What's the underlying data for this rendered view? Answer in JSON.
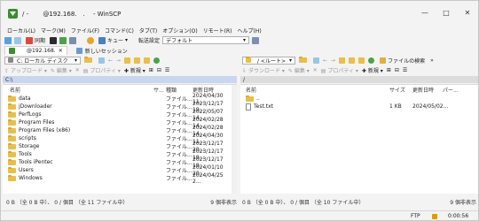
{
  "window": {
    "title": "/ - 　　@192.168.　.　 - WinSCP",
    "min_glyph": "—",
    "max_glyph": "□",
    "close_glyph": "✕"
  },
  "menu": [
    "ローカル(L)",
    "マーク(M)",
    "ファイル(F)",
    "コマンド(C)",
    "タブ(T)",
    "オプション(O)",
    "リモート(R)",
    "ヘルプ(H)"
  ],
  "toolbar": {
    "sync_label": "同期",
    "queue_label": "キュー",
    "transfer_label": "転送設定",
    "transfer_value": "デフォルト"
  },
  "tabs": {
    "session_label": "@192.168.",
    "new_session_label": "新しいセッション"
  },
  "local": {
    "drive_label": "C: ローカル ディスク",
    "upload_label": "アップロード",
    "edit_label": "編集",
    "props_label": "プロパティ",
    "new_label": "新規",
    "path": "C:\\",
    "columns": {
      "name": "名前",
      "size": "サ...",
      "type": "種類",
      "changed": "更新日時"
    },
    "files": [
      {
        "name": "data",
        "type": "ファイル...",
        "changed": "2024/04/30 11..."
      },
      {
        "name": "jDownloader",
        "type": "ファイル...",
        "changed": "2023/12/17 19..."
      },
      {
        "name": "PerfLogs",
        "type": "ファイル...",
        "changed": "2022/05/07 14..."
      },
      {
        "name": "Program Files",
        "type": "ファイル...",
        "changed": "2024/02/28 14..."
      },
      {
        "name": "Program Files (x86)",
        "type": "ファイル...",
        "changed": "2024/02/28 14..."
      },
      {
        "name": "scripts",
        "type": "ファイル...",
        "changed": "2024/04/30 11..."
      },
      {
        "name": "Storage",
        "type": "ファイル...",
        "changed": "2023/12/17 20..."
      },
      {
        "name": "Tools",
        "type": "ファイル...",
        "changed": "2023/12/17 19..."
      },
      {
        "name": "Tools iPentec",
        "type": "ファイル...",
        "changed": "2023/12/17 19..."
      },
      {
        "name": "Users",
        "type": "ファイル...",
        "changed": "2024/01/10 20..."
      },
      {
        "name": "Windows",
        "type": "ファイル...",
        "changed": "2024/04/25 2..."
      }
    ],
    "status": "0 B （全 0 B 中）、 0 / 個目 （全 11 ファイル中）",
    "hidden": "9 個非表示"
  },
  "remote": {
    "drive_label": "/ <ルート>",
    "download_label": "ダウンロード",
    "edit_label": "編集",
    "props_label": "プロパティ",
    "new_label": "新規",
    "find_label": "ファイルの検索",
    "path": "/",
    "columns": {
      "name": "名前",
      "size": "サイズ",
      "changed": "更新日時",
      "perm": "パー..."
    },
    "parent_label": "..",
    "files": [
      {
        "name": "Test.txt",
        "size": "1 KB",
        "changed": "2024/05/02..."
      }
    ],
    "status": "0 B （全 0 B 中）、 0 / 個目 （全 10 ファイル中）",
    "hidden": "9 個非表示"
  },
  "statusbar": {
    "protocol": "FTP",
    "time": "0:00:56"
  },
  "colors": {
    "accent": "#1f5fbf",
    "folder": "#e9be4a",
    "path_active": "#c9d7ee"
  }
}
